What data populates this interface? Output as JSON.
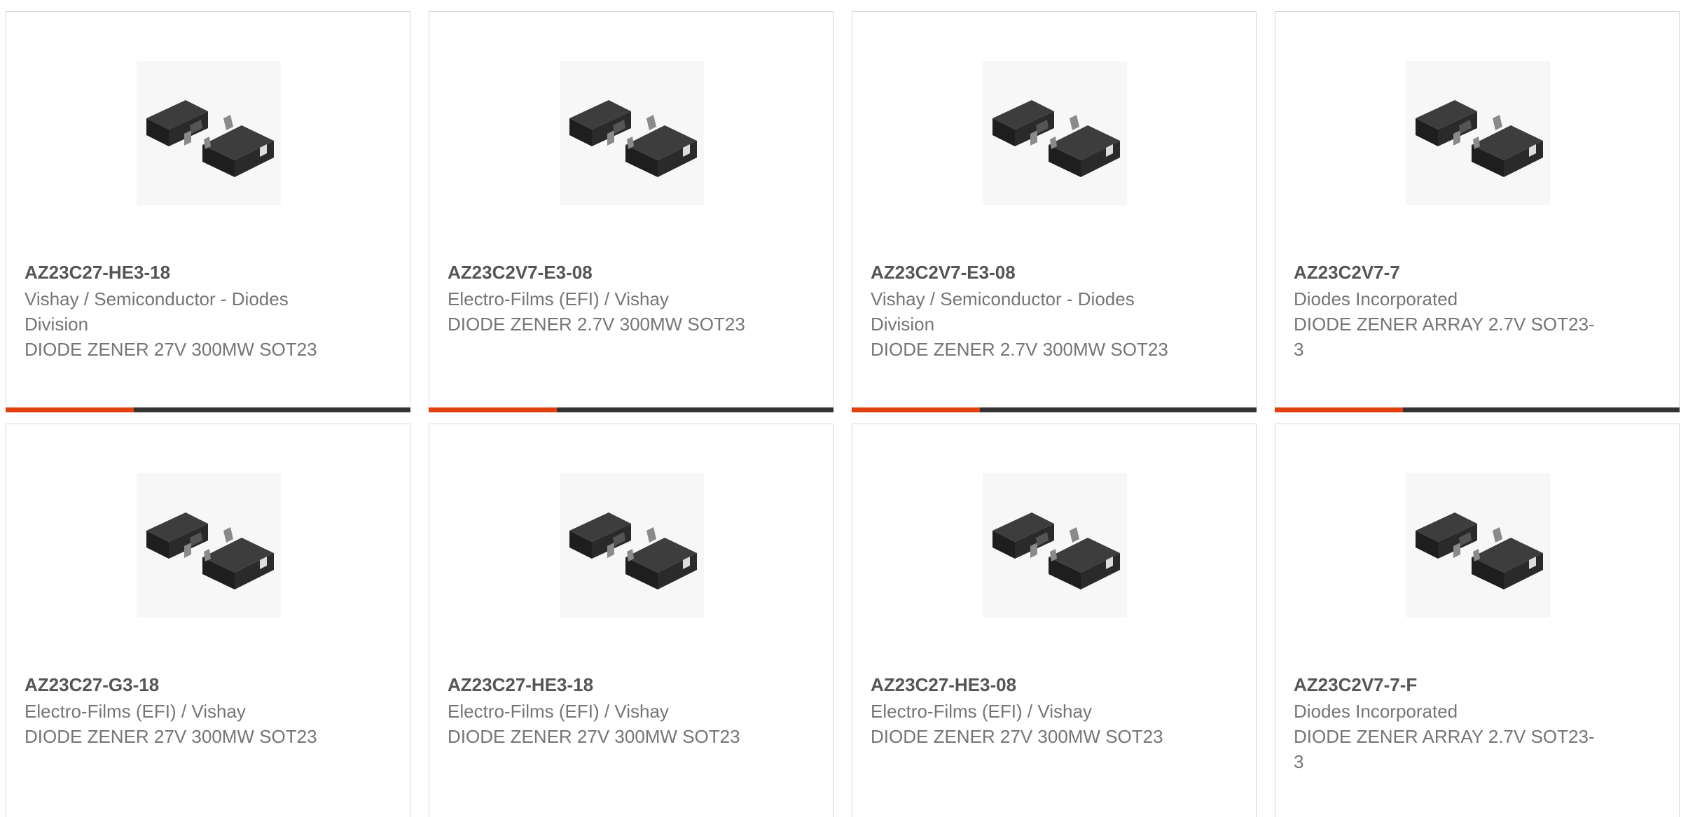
{
  "products": [
    {
      "part_number": "AZ23C27-HE3-18",
      "manufacturer": "Vishay / Semiconductor - Diodes Division",
      "description": "DIODE ZENER 27V 300MW SOT23",
      "image_icon": "sot23-package-icon"
    },
    {
      "part_number": "AZ23C2V7-E3-08",
      "manufacturer": "Electro-Films (EFI) / Vishay",
      "description": "DIODE ZENER 2.7V 300MW SOT23",
      "image_icon": "sot23-package-icon"
    },
    {
      "part_number": "AZ23C2V7-E3-08",
      "manufacturer": "Vishay / Semiconductor - Diodes Division",
      "description": "DIODE ZENER 2.7V 300MW SOT23",
      "image_icon": "sot23-package-icon"
    },
    {
      "part_number": "AZ23C2V7-7",
      "manufacturer": "Diodes Incorporated",
      "description": "DIODE ZENER ARRAY 2.7V SOT23-3",
      "image_icon": "sot23-package-icon"
    },
    {
      "part_number": "AZ23C27-G3-18",
      "manufacturer": "Electro-Films (EFI) / Vishay",
      "description": "DIODE ZENER 27V 300MW SOT23",
      "image_icon": "sot23-package-icon"
    },
    {
      "part_number": "AZ23C27-HE3-18",
      "manufacturer": "Electro-Films (EFI) / Vishay",
      "description": "DIODE ZENER 27V 300MW SOT23",
      "image_icon": "sot23-package-icon"
    },
    {
      "part_number": "AZ23C27-HE3-08",
      "manufacturer": "Electro-Films (EFI) / Vishay",
      "description": "DIODE ZENER 27V 300MW SOT23",
      "image_icon": "sot23-package-icon"
    },
    {
      "part_number": "AZ23C2V7-7-F",
      "manufacturer": "Diodes Incorporated",
      "description": "DIODE ZENER ARRAY 2.7V SOT23-3",
      "image_icon": "sot23-package-icon"
    }
  ],
  "colors": {
    "accent": "#e4400f",
    "bar": "#333333",
    "border": "#d6d6d6",
    "part_number_text": "#555555",
    "body_text": "#757575"
  }
}
